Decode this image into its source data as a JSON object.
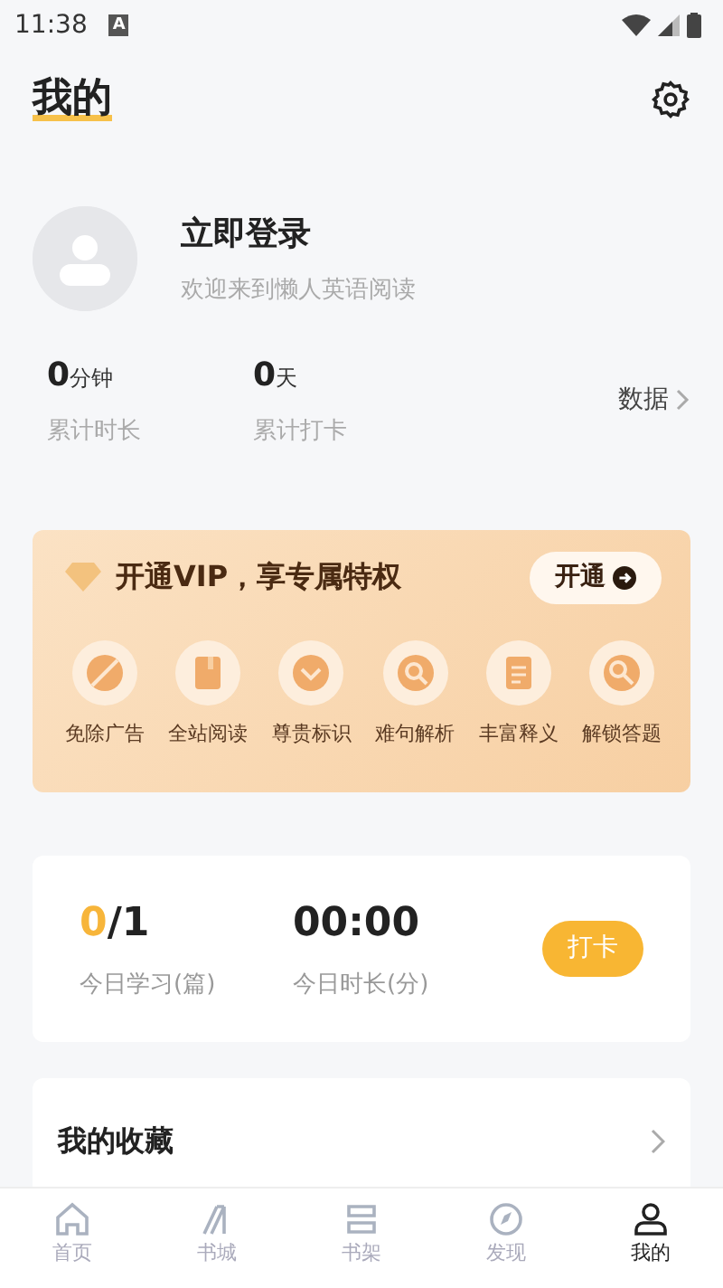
{
  "status_bar": {
    "time": "11:38",
    "indicator": "A"
  },
  "header": {
    "title": "我的"
  },
  "profile": {
    "login": "立即登录",
    "welcome": "欢迎来到懒人英语阅读"
  },
  "stats": [
    {
      "value": "0",
      "unit": "分钟",
      "label": "累计时长"
    },
    {
      "value": "0",
      "unit": "天",
      "label": "累计打卡"
    }
  ],
  "data_link": "数据",
  "vip": {
    "title": "开通VIP，享专属特权",
    "button": "开通",
    "perks": [
      "免除广告",
      "全站阅读",
      "尊贵标识",
      "难句解析",
      "丰富释义",
      "解锁答题"
    ]
  },
  "today": {
    "done": "0",
    "total": "/1",
    "time": "00:00",
    "count_label": "今日学习(篇)",
    "time_label": "今日时长(分)",
    "button": "打卡"
  },
  "menu": [
    "我的收藏"
  ],
  "tabs": [
    {
      "label": "首页",
      "selected": false
    },
    {
      "label": "书城",
      "selected": false
    },
    {
      "label": "书架",
      "selected": false
    },
    {
      "label": "发现",
      "selected": false
    },
    {
      "label": "我的",
      "selected": true
    }
  ]
}
